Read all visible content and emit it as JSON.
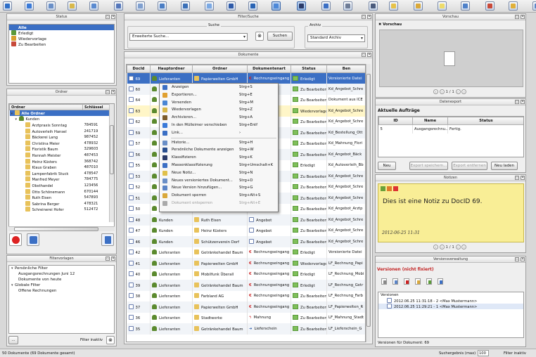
{
  "toolbar": {
    "icons": [
      "save-icon",
      "save-as-icon",
      "export-icon",
      "mail-icon",
      "print-icon",
      "calendar-icon",
      "scan-icon",
      "archive-icon",
      "history-icon",
      "layout-icon",
      "network-icon",
      "multi-window-icon",
      "chat-icon",
      "tools-icon",
      "workflow-icon",
      "split-icon",
      "settings-icon",
      "document-icon",
      "copy-icon",
      "edit-icon",
      "new-doc-icon",
      "pdf-icon",
      "stamp-icon",
      "page-icon"
    ]
  },
  "status_panel": {
    "title": "Status",
    "items": [
      "Alle",
      "Erledigt",
      "Wiedervorlage",
      "Zu Bearbeiten"
    ]
  },
  "folder_panel": {
    "title": "Ordner",
    "col_ordner": "Ordner",
    "col_key": "Schlüssel",
    "root": "Alle Ordner",
    "group": "Kunden",
    "rows": [
      {
        "name": "Arztpraxis Sonntag",
        "key": "784591"
      },
      {
        "name": "Autoverleih Hansel",
        "key": "241719"
      },
      {
        "name": "Bäckerei Lang",
        "key": "987452"
      },
      {
        "name": "Christina Meier",
        "key": "478932"
      },
      {
        "name": "Floristik Baum",
        "key": "329603"
      },
      {
        "name": "Hannah Meister",
        "key": "487453"
      },
      {
        "name": "Heinz Küsters",
        "key": "368742"
      },
      {
        "name": "Klaus Graben",
        "key": "487010"
      },
      {
        "name": "Lampenfabrik Stuck",
        "key": "478547"
      },
      {
        "name": "Manfred Meyer",
        "key": "784775"
      },
      {
        "name": "Obsthandel",
        "key": "123456"
      },
      {
        "name": "Otto Schönemann",
        "key": "670144"
      },
      {
        "name": "Ruth Eisen",
        "key": "547893"
      },
      {
        "name": "Sabrina Berger",
        "key": "478321"
      },
      {
        "name": "Schreinerei Hofer",
        "key": "512472"
      }
    ]
  },
  "filter_panel": {
    "title": "Filtervorlagen",
    "tree": [
      {
        "label": "Persönliche Filter",
        "level": 0
      },
      {
        "label": "Ausgangsrechnungen Juni 12",
        "level": 1
      },
      {
        "label": "Dokumente von heute",
        "level": 1
      },
      {
        "label": "Globale Filter",
        "level": 0
      },
      {
        "label": "Offene Rechnungen",
        "level": 1
      }
    ],
    "more_button": "...",
    "filter_status": "Filter inaktiv"
  },
  "search_panel": {
    "title": "Filter/Suche",
    "group_search": "Suche",
    "search_combo": "Erweiterte Suche...",
    "search_button": "Suchen",
    "group_archive": "Archiv",
    "archive_combo": "Standard Archiv"
  },
  "documents_panel": {
    "title": "Dokumente",
    "columns": [
      "DocId",
      "Hauptordner",
      "Ordner",
      "Dokumentenart",
      "Status",
      "Ben"
    ],
    "rows": [
      {
        "id": "69",
        "main": "Lieferanten",
        "folder": "Papierwelten GmbH",
        "type": "Rechnungseingang",
        "status": "Erledigt",
        "name": "Versionierte Datei",
        "mi": "person",
        "ti": "euro",
        "si": "flag",
        "state": "sel"
      },
      {
        "id": "60",
        "main": "",
        "folder": "",
        "type": "",
        "status": "Zu Bearbeiten",
        "name": "Kd_Angebot_Schre",
        "mi": "person",
        "ti": "doc",
        "si": "flag",
        "state": ""
      },
      {
        "id": "64",
        "main": "",
        "folder": "",
        "type": "",
        "status": "Zu Bearbeiten",
        "name": "Dokument aus ICE",
        "mi": "person",
        "ti": "doc",
        "si": "flag",
        "state": ""
      },
      {
        "id": "63",
        "main": "",
        "folder": "",
        "type": "",
        "status": "Wiedervorlage",
        "name": "Kd_Angebot_Schre",
        "mi": "person",
        "ti": "doc",
        "si": "flag",
        "state": "hl"
      },
      {
        "id": "62",
        "main": "",
        "folder": "",
        "type": "",
        "status": "Zu Bearbeiten",
        "name": "Kd_Angebot_Schre",
        "mi": "person",
        "ti": "doc",
        "si": "flag",
        "state": ""
      },
      {
        "id": "59",
        "main": "",
        "folder": "",
        "type": "ng",
        "status": "Zu Bearbeiten",
        "name": "Kd_Bestellung_Ott",
        "mi": "person",
        "ti": "doc",
        "si": "flag",
        "state": ""
      },
      {
        "id": "57",
        "main": "",
        "folder": "",
        "type": "ng",
        "status": "Zu Bearbeiten",
        "name": "Kd_Mahnung_Flori",
        "mi": "person",
        "ti": "doc",
        "si": "flag",
        "state": ""
      },
      {
        "id": "56",
        "main": "",
        "folder": "",
        "type": "",
        "status": "Zu Bearbeiten",
        "name": "Kd_Angebot_Bäck",
        "mi": "person",
        "ti": "doc",
        "si": "flag",
        "state": ""
      },
      {
        "id": "55",
        "main": "",
        "folder": "",
        "type": "",
        "status": "Erledigt",
        "name": "Kd_Autoverleih_Bb",
        "mi": "person",
        "ti": "doc",
        "si": "flag",
        "state": ""
      },
      {
        "id": "53",
        "main": "",
        "folder": "",
        "type": "",
        "status": "Zu Bearbeiten",
        "name": "Kd_Angebot_Schre",
        "mi": "person",
        "ti": "doc",
        "si": "flag",
        "state": ""
      },
      {
        "id": "52",
        "main": "",
        "folder": "",
        "type": "",
        "status": "Zu Bearbeiten",
        "name": "Kd_Angebot_Schre",
        "mi": "person",
        "ti": "doc",
        "si": "flag",
        "state": ""
      },
      {
        "id": "51",
        "main": "",
        "folder": "",
        "type": "",
        "status": "Zu Bearbeiten",
        "name": "Kd_Angebot_Schre",
        "mi": "person",
        "ti": "doc",
        "si": "flag",
        "state": ""
      },
      {
        "id": "50",
        "main": "Nicht zugeordnet",
        "folder": "Nicht zugeordnet",
        "type": "Angebot",
        "status": "Zu Bearbeiten",
        "name": "Kd_Angebot_Arztp",
        "mi": "person",
        "ti": "doc",
        "si": "flag",
        "state": ""
      },
      {
        "id": "48",
        "main": "Kunden",
        "folder": "Ruth Eisen",
        "type": "Angebot",
        "status": "Zu Bearbeiten",
        "name": "Kd_Angebot_Schre",
        "mi": "person",
        "ti": "doc",
        "si": "flag",
        "state": ""
      },
      {
        "id": "47",
        "main": "Kunden",
        "folder": "Heinz Küsters",
        "type": "Angebot",
        "status": "Zu Bearbeiten",
        "name": "Kd_Angebot_Schre",
        "mi": "person",
        "ti": "doc",
        "si": "flag",
        "state": ""
      },
      {
        "id": "46",
        "main": "Kunden",
        "folder": "Schützenverein Dorf",
        "type": "Angebot",
        "status": "Zu Bearbeiten",
        "name": "Kd_Angebot_Schre",
        "mi": "person",
        "ti": "doc",
        "si": "flag",
        "state": ""
      },
      {
        "id": "42",
        "main": "Lieferanten",
        "folder": "Getränkehandel Baum",
        "type": "Rechnungseingang",
        "status": "Erledigt",
        "name": "Versionierte Datei",
        "mi": "person",
        "ti": "euro",
        "si": "flag",
        "state": ""
      },
      {
        "id": "41",
        "main": "Lieferanten",
        "folder": "Papierwelten GmbH",
        "type": "Rechnungseingang",
        "status": "Wiedervorlage",
        "name": "LF_Rechnung_Papi",
        "mi": "person",
        "ti": "euro",
        "si": "flag",
        "state": ""
      },
      {
        "id": "40",
        "main": "Lieferanten",
        "folder": "Mobilfunk Überall",
        "type": "Rechnungseingang",
        "status": "Erledigt",
        "name": "LF_Rechnung_Mobi",
        "mi": "person",
        "ti": "euro",
        "si": "flag",
        "state": ""
      },
      {
        "id": "39",
        "main": "Lieferanten",
        "folder": "Getränkehandel Baum",
        "type": "Rechnungseingang",
        "status": "Erledigt",
        "name": "LF_Rechnung_Getr",
        "mi": "person",
        "ti": "euro",
        "si": "flag",
        "state": ""
      },
      {
        "id": "38",
        "main": "Lieferanten",
        "folder": "Farbland AG",
        "type": "Rechnungseingang",
        "status": "Zu Bearbeiten",
        "name": "LF_Rechnung_Farb",
        "mi": "person",
        "ti": "euro",
        "si": "flag",
        "state": ""
      },
      {
        "id": "37",
        "main": "Lieferanten",
        "folder": "Papierwelten GmbH",
        "type": "Rechnungseingang",
        "status": "Zu Bearbeiten",
        "name": "LF_Papierwelten_R",
        "mi": "person",
        "ti": "euro",
        "si": "flag",
        "state": ""
      },
      {
        "id": "36",
        "main": "Lieferanten",
        "folder": "Stadtwerke",
        "type": "Mahnung",
        "status": "Zu Bearbeiten",
        "name": "LF_Mahnung_Stadt",
        "mi": "person",
        "ti": "warn",
        "si": "flag",
        "state": ""
      },
      {
        "id": "35",
        "main": "Lieferanten",
        "folder": "Getränkehandel Baum",
        "type": "Lieferschein",
        "status": "Zu Bearbeiten",
        "name": "LF_Lieferschein_G",
        "mi": "person",
        "ti": "arrow",
        "si": "flag",
        "state": ""
      }
    ]
  },
  "context_menu": {
    "items": [
      {
        "label": "Anzeigen",
        "key": "Strg+S",
        "type": "item"
      },
      {
        "label": "Exportieren...",
        "key": "Strg+E",
        "type": "item"
      },
      {
        "label": "Versenden",
        "key": "Strg+M",
        "type": "item"
      },
      {
        "label": "Wiedervorlagen",
        "key": "Strg+Z",
        "type": "item"
      },
      {
        "label": "Archivieren...",
        "key": "Strg+A",
        "type": "item"
      },
      {
        "label": "In den Mülleimer verschieben",
        "key": "Strg+Entf",
        "type": "item"
      },
      {
        "label": "Link...",
        "key": "›",
        "type": "item"
      },
      {
        "type": "sep"
      },
      {
        "label": "Historie...",
        "key": "Strg+H",
        "type": "item"
      },
      {
        "label": "Persönliche Dokumente  anzeigen",
        "key": "Strg+W",
        "type": "item"
      },
      {
        "label": "Klassifizieren",
        "key": "Strg+K",
        "type": "item"
      },
      {
        "label": "Massenklassifizierung",
        "key": "Strg+Umschalt+K",
        "type": "item"
      },
      {
        "label": "Neue Notiz...",
        "key": "Strg+N",
        "type": "item"
      },
      {
        "label": "Neues versioniertes Dokument...",
        "key": "Strg+D",
        "type": "item"
      },
      {
        "label": "Neue Version hinzufügen...",
        "key": "Strg+G",
        "type": "item"
      },
      {
        "label": "Dokument sperren",
        "key": "Strg+Alt+S",
        "type": "item"
      },
      {
        "label": "Dokument entsperren",
        "key": "Strg+Alt+E",
        "type": "dis"
      }
    ]
  },
  "preview_panel": {
    "title": "Vorschau",
    "tab": "Vorschau",
    "pager": "1 / 1"
  },
  "export_panel": {
    "title": "Datenexport",
    "heading": "Aktuelle Aufträge",
    "columns": [
      "ID",
      "Name",
      "Status"
    ],
    "rows": [
      {
        "id": "5",
        "name": "Ausgangsrechnu...",
        "status": "Fertig."
      }
    ],
    "buttons": [
      "Neu",
      "Export speichern...",
      "Export entfernen",
      "Neu laden"
    ]
  },
  "notes_panel": {
    "title": "Notizen",
    "note_text": "Dies ist eine Notiz zu DocID 69.",
    "note_date": "2012-06-25 11:31",
    "pager": "1 / 1"
  },
  "version_panel": {
    "title": "Versionsverwaltung",
    "heading": "Versionen (nicht fixiert)",
    "tree_root": "Versionen",
    "versions": [
      "2012.06.25 11:31:18 - 2 <Max Mustermann>",
      "2012.06.25 11:29:21 - 1 <Max Mustermann>"
    ],
    "footer": "Versionen für Dokument: 69"
  },
  "statusbar": {
    "left": "50 Dokumente (69 Dokumente gesamt)",
    "results_label": "Suchergebnis (max)",
    "results_value": "100",
    "filter": "Filter inaktiv"
  },
  "colors": {
    "selection": "#3b6fc4",
    "note": "#f9ee96",
    "panel": "#efefef",
    "accent_red": "#c22222"
  }
}
